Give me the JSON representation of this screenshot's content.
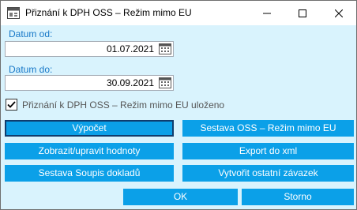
{
  "window": {
    "title": "Přiznání k DPH OSS – Režim mimo EU",
    "icon": "report-window-icon",
    "controls": [
      "minimize-icon",
      "maximize-icon",
      "close-icon"
    ]
  },
  "form": {
    "date_from": {
      "label": "Datum od:",
      "value": "01.07.2021",
      "icon": "calendar-icon"
    },
    "date_to": {
      "label": "Datum do:",
      "value": "30.09.2021",
      "icon": "calendar-icon"
    },
    "saved_checkbox": {
      "label": "Přiznání k DPH OSS – Režim mimo EU uloženo",
      "checked": true
    }
  },
  "buttons": {
    "calculate": "Výpočet",
    "report_oss": "Sestava OSS – Režim mimo EU",
    "view_edit": "Zobrazit/upravit hodnoty",
    "export_xml": "Export do xml",
    "documents_list": "Sestava Soupis dokladů",
    "create_liability": "Vytvořit ostatní závazek",
    "ok": "OK",
    "cancel": "Storno"
  },
  "colors": {
    "background": "#d9f3fd",
    "button": "#0ba0e8",
    "label": "#1677c7"
  }
}
